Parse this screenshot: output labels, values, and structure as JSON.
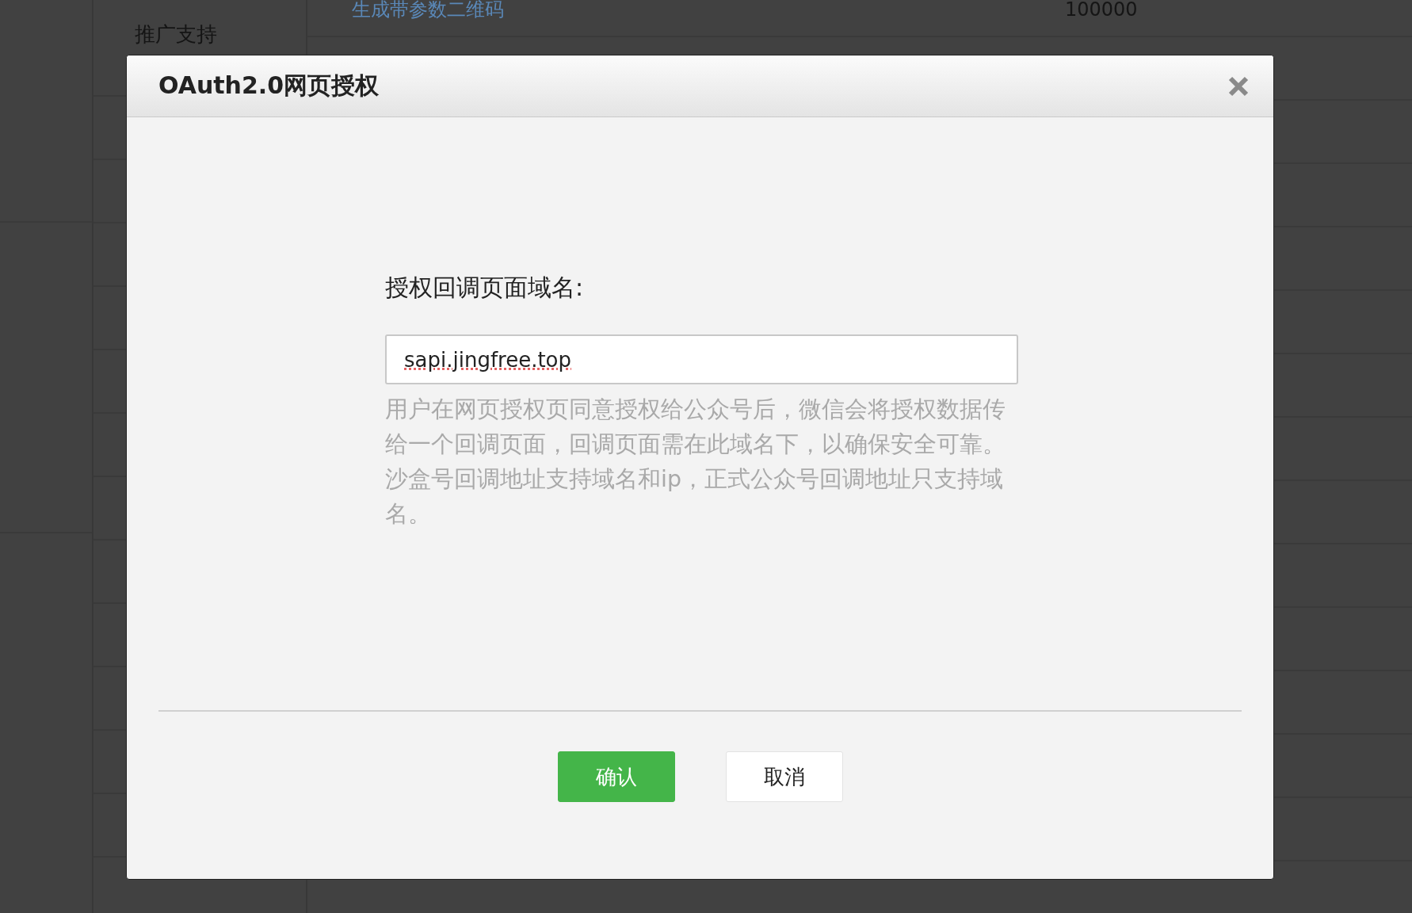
{
  "background": {
    "section_label": "推广支持",
    "table_rows": [
      {
        "link": "生成带参数二维码",
        "value": "100000"
      }
    ]
  },
  "dialog": {
    "title": "OAuth2.0网页授权",
    "field_label": "授权回调页面域名:",
    "field_value": "sapi.jingfree.top",
    "hint": "用户在网页授权页同意授权给公众号后，微信会将授权数据传给一个回调页面，回调页面需在此域名下，以确保安全可靠。沙盒号回调地址支持域名和ip，正式公众号回调地址只支持域名。",
    "buttons": [
      {
        "label": "确认",
        "kind": "primary"
      },
      {
        "label": "取消",
        "kind": "default"
      }
    ]
  }
}
